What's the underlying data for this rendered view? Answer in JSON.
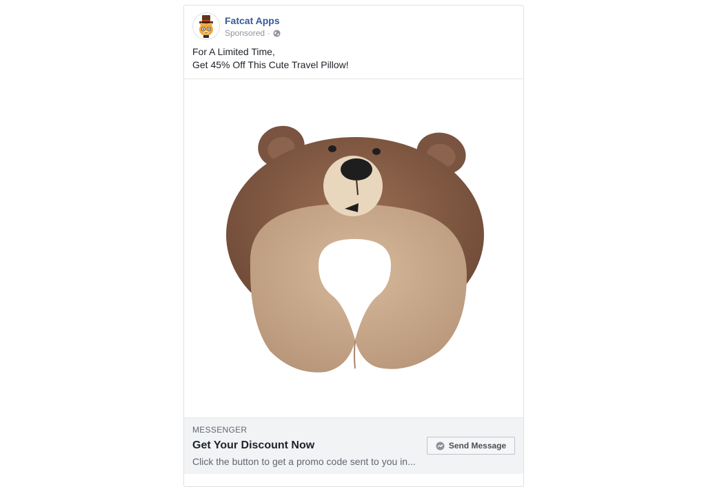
{
  "post": {
    "page_name": "Fatcat Apps",
    "sponsored_label": "Sponsored",
    "separator": "·",
    "privacy_icon": "globe-icon",
    "text_lines": [
      "For A Limited Time,",
      "Get 45% Off This Cute Travel Pillow!"
    ]
  },
  "image": {
    "subject": "bear-shaped-travel-pillow",
    "colors": {
      "dark_brown": "#7a5440",
      "light_tan": "#c9a889",
      "snout": "#e8d6bd",
      "nose": "#1e1e1e"
    }
  },
  "footer": {
    "source": "MESSENGER",
    "headline": "Get Your Discount Now",
    "description": "Click the button to get a promo code sent to you in...",
    "cta_label": "Send Message",
    "cta_icon": "messenger-icon"
  },
  "colors": {
    "link_blue": "#385898",
    "border": "#dddfe2",
    "footer_bg": "#f2f3f5",
    "meta_gray": "#90949c"
  }
}
